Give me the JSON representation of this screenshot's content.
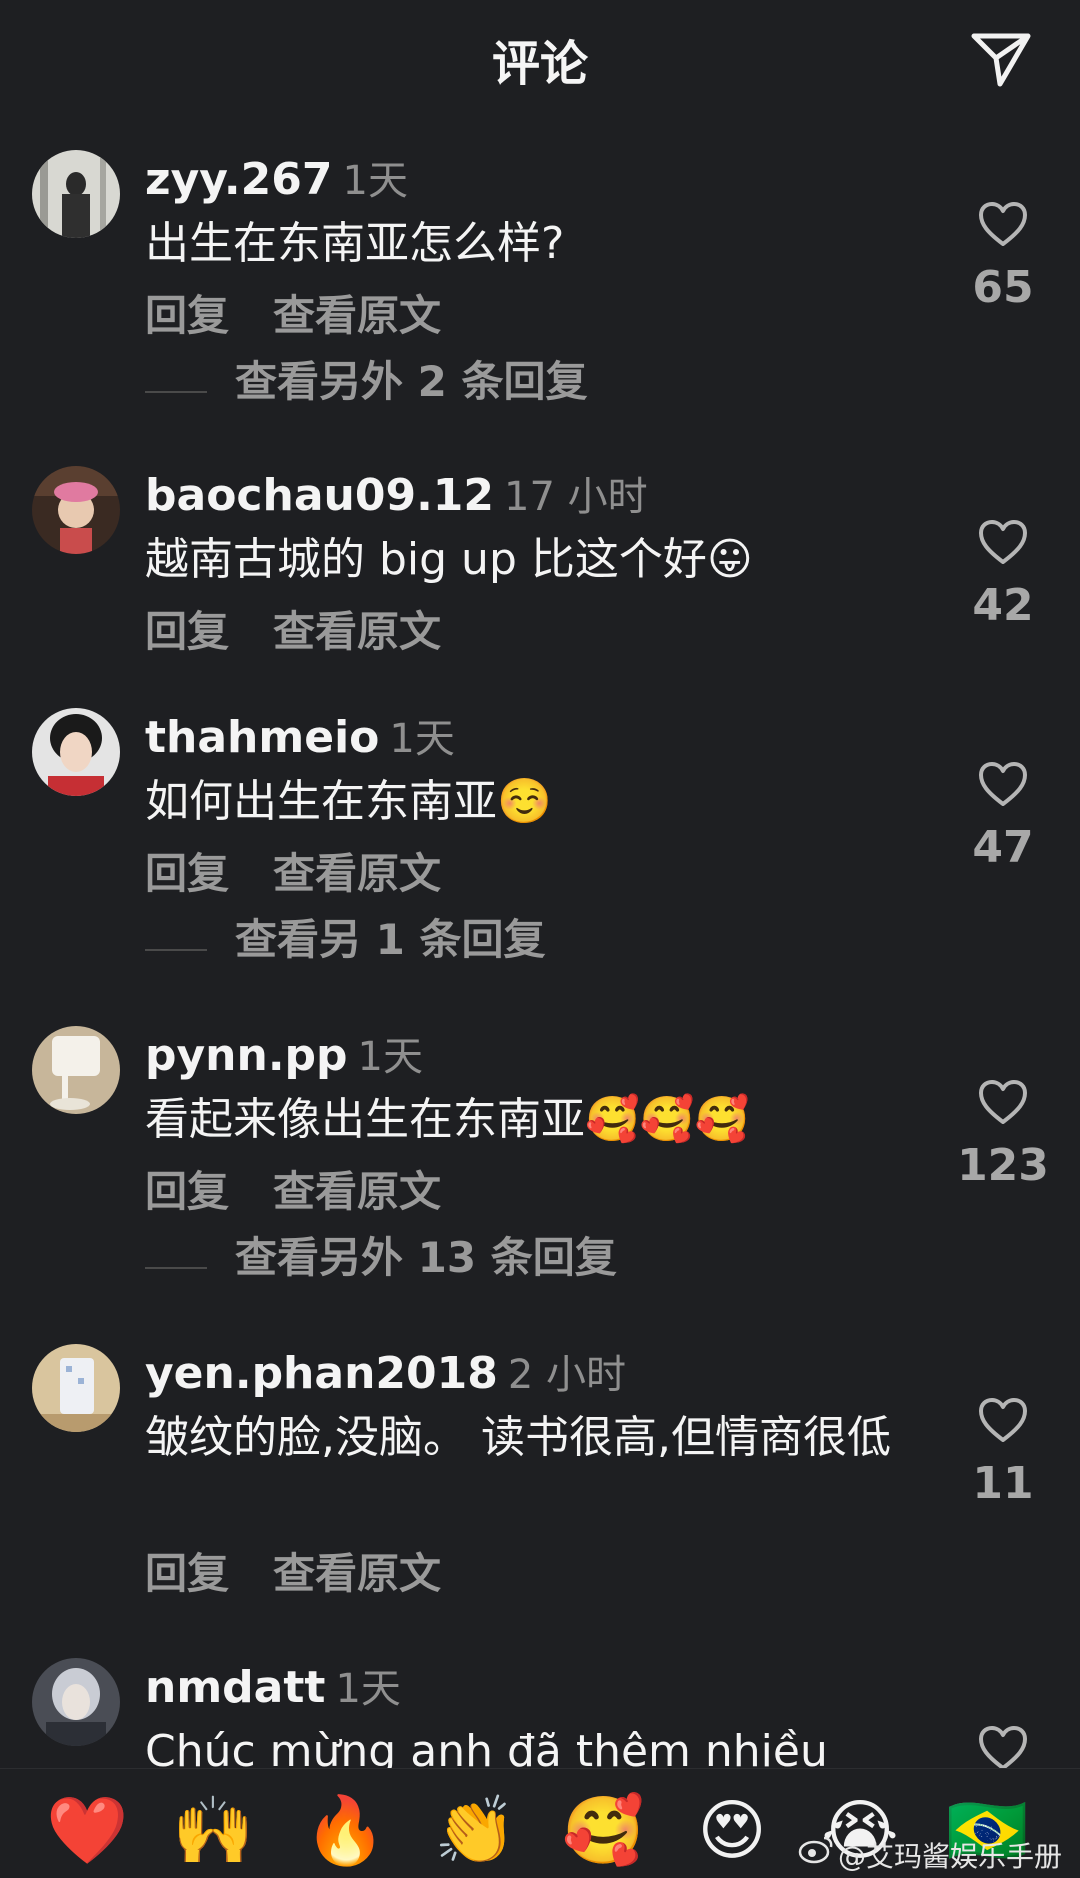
{
  "header": {
    "title": "评论"
  },
  "comments": [
    {
      "username": "zyy.267",
      "time": "1天",
      "text": "出生在东南亚怎么样?",
      "likes": "65",
      "reply_label": "回复",
      "translate_label": "查看原文",
      "more_replies": "查看另外 2 条回复"
    },
    {
      "username": "baochau09.12",
      "time": "17 小时",
      "text": "越南古城的 big up 比这个好😛",
      "likes": "42",
      "reply_label": "回复",
      "translate_label": "查看原文"
    },
    {
      "username": "thahmeio",
      "time": "1天",
      "text": "如何出生在东南亚☺️",
      "likes": "47",
      "reply_label": "回复",
      "translate_label": "查看原文",
      "more_replies": "查看另 1 条回复"
    },
    {
      "username": "pynn.pp",
      "time": "1天",
      "text": "看起来像出生在东南亚🥰🥰🥰",
      "likes": "123",
      "reply_label": "回复",
      "translate_label": "查看原文",
      "more_replies": "查看另外 13 条回复"
    },
    {
      "username": "yen.phan2018",
      "time": "2 小时",
      "text": "皱纹的脸,没脑。 读书很高,但情商很低",
      "likes": "11",
      "reply_label": "回复",
      "translate_label": "查看原文"
    },
    {
      "username": "nmdatt",
      "time": "1天",
      "text": "Chúc mừng anh đã thêm nhiều"
    }
  ],
  "emoji_bar": [
    "❤️",
    "🙌",
    "🔥",
    "👏",
    "🥰",
    "😍",
    "😭",
    "🇧🇷"
  ],
  "watermark": "@艾玛酱娱乐手册",
  "colors": {
    "background": "#1e1f22",
    "text": "#f4f4f4",
    "muted": "#9a9a9a",
    "time": "#8f8f8f"
  }
}
